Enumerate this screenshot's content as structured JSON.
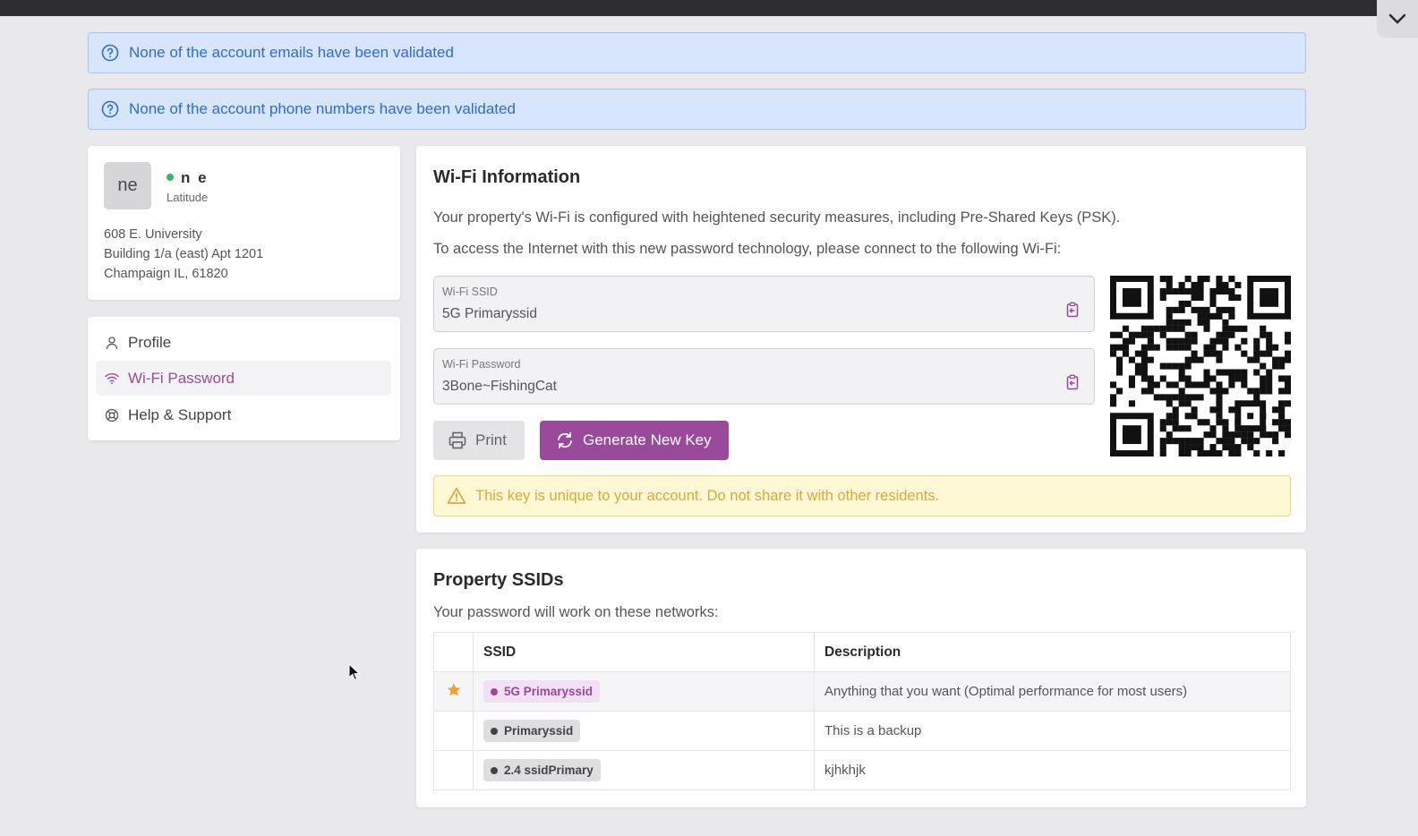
{
  "alerts": {
    "emails": "None of the account emails have been validated",
    "phones": "None of the account phone numbers have been validated"
  },
  "user": {
    "initials": "ne",
    "name": "n e",
    "subtitle": "Latitude",
    "status_color": "#3bb36a",
    "address": [
      "608 E. University",
      "Building 1/a (east) Apt 1201",
      "Champaign IL, 61820"
    ]
  },
  "nav": {
    "items": [
      {
        "label": "Profile",
        "icon": "person-icon",
        "active": false
      },
      {
        "label": "Wi-Fi Password",
        "icon": "wifi-icon",
        "active": true
      },
      {
        "label": "Help & Support",
        "icon": "lifebuoy-icon",
        "active": false
      }
    ]
  },
  "wifi": {
    "title": "Wi-Fi Information",
    "intro": "Your property's Wi-Fi is configured with heightened security measures, including Pre-Shared Keys (PSK).",
    "instructions": "To access the Internet with this new password technology, please connect to the following Wi-Fi:",
    "ssid_label": "Wi-Fi SSID",
    "ssid_value": "5G Primaryssid",
    "password_label": "Wi-Fi Password",
    "password_value": "3Bone~FishingCat",
    "print_label": "Print",
    "generate_label": "Generate New Key",
    "warning": "This key is unique to your account. Do not share it with other residents."
  },
  "property": {
    "title": "Property SSIDs",
    "subtitle": "Your password will work on these networks:",
    "columns": [
      "SSID",
      "Description"
    ],
    "rows": [
      {
        "ssid": "5G Primaryssid",
        "description": "Anything that you want (Optimal performance for most users)",
        "starred": true
      },
      {
        "ssid": "Primaryssid",
        "description": "This is a backup",
        "starred": false
      },
      {
        "ssid": "2.4 ssidPrimary",
        "description": "kjhkhjk",
        "starred": false
      }
    ]
  },
  "colors": {
    "accent": "#9a4a9b",
    "info_bg": "#d8e6fb",
    "info_text": "#2f6bd0",
    "warn_bg": "#fff8d5",
    "warn_text": "#d8a93a",
    "star": "#f0a22e"
  }
}
